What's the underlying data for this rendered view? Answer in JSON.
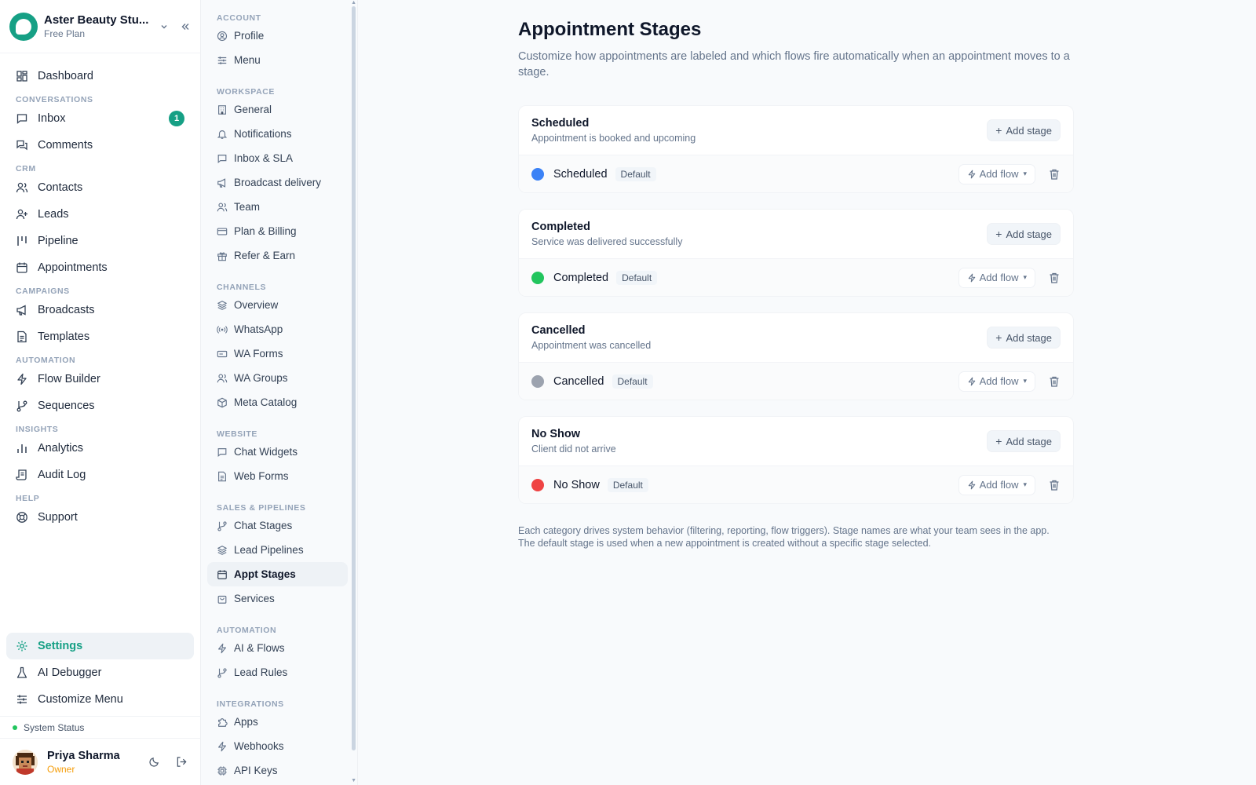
{
  "workspace": {
    "name": "Aster Beauty Stu...",
    "plan": "Free Plan"
  },
  "sidebar": {
    "items": {
      "dashboard": "Dashboard",
      "inbox": "Inbox",
      "comments": "Comments",
      "contacts": "Contacts",
      "leads": "Leads",
      "pipeline": "Pipeline",
      "appointments": "Appointments",
      "broadcasts": "Broadcasts",
      "templates": "Templates",
      "flow_builder": "Flow Builder",
      "sequences": "Sequences",
      "analytics": "Analytics",
      "audit_log": "Audit Log",
      "support": "Support",
      "settings": "Settings",
      "ai_debugger": "AI Debugger",
      "customize_menu": "Customize Menu"
    },
    "sections": {
      "conversations": "CONVERSATIONS",
      "crm": "CRM",
      "campaigns": "CAMPAIGNS",
      "automation": "AUTOMATION",
      "insights": "INSIGHTS",
      "help": "HELP"
    },
    "inbox_badge": "1",
    "system_status": "System Status",
    "user": {
      "name": "Priya Sharma",
      "role": "Owner"
    }
  },
  "settings_nav": {
    "sections": {
      "account": "ACCOUNT",
      "workspace": "WORKSPACE",
      "channels": "CHANNELS",
      "website": "WEBSITE",
      "sales": "SALES & PIPELINES",
      "automation": "AUTOMATION",
      "integrations": "INTEGRATIONS"
    },
    "items": {
      "profile": "Profile",
      "menu": "Menu",
      "general": "General",
      "notifications": "Notifications",
      "inbox_sla": "Inbox & SLA",
      "broadcast_delivery": "Broadcast delivery",
      "team": "Team",
      "plan_billing": "Plan & Billing",
      "refer_earn": "Refer & Earn",
      "overview": "Overview",
      "whatsapp": "WhatsApp",
      "wa_forms": "WA Forms",
      "wa_groups": "WA Groups",
      "meta_catalog": "Meta Catalog",
      "chat_widgets": "Chat Widgets",
      "web_forms": "Web Forms",
      "chat_stages": "Chat Stages",
      "lead_pipelines": "Lead Pipelines",
      "appt_stages": "Appt Stages",
      "services": "Services",
      "ai_flows": "AI & Flows",
      "lead_rules": "Lead Rules",
      "apps": "Apps",
      "webhooks": "Webhooks",
      "api_keys": "API Keys"
    }
  },
  "main": {
    "title": "Appointment Stages",
    "subtitle": "Customize how appointments are labeled and which flows fire automatically when an appointment moves to a stage.",
    "add_stage_label": "Add stage",
    "add_flow_label": "Add flow",
    "default_label": "Default",
    "categories": [
      {
        "title": "Scheduled",
        "desc": "Appointment is booked and upcoming",
        "stage": "Scheduled",
        "color": "#3b82f6"
      },
      {
        "title": "Completed",
        "desc": "Service was delivered successfully",
        "stage": "Completed",
        "color": "#22c55e"
      },
      {
        "title": "Cancelled",
        "desc": "Appointment was cancelled",
        "stage": "Cancelled",
        "color": "#9ca3af"
      },
      {
        "title": "No Show",
        "desc": "Client did not arrive",
        "stage": "No Show",
        "color": "#ef4444"
      }
    ],
    "footer_line1": "Each category drives system behavior (filtering, reporting, flow triggers). Stage names are what your team sees in the app.",
    "footer_line2": "The default stage is used when a new appointment is created without a specific stage selected."
  },
  "colors": {
    "accent": "#16a085",
    "owner": "#f59e0b"
  }
}
